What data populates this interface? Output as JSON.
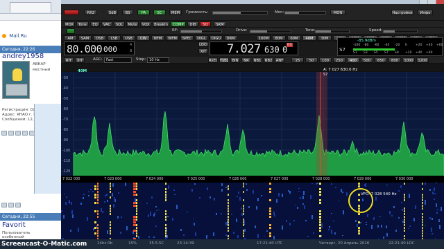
{
  "browser": {
    "bookmark": "Mail.Ru",
    "post1_date": "Сегодня, 22:26",
    "post1_user": "andrey1958",
    "post1_role": "АВКАР",
    "post1_status": "местный",
    "post1_reg": "Регистрация: 02.12.2010",
    "post1_addr": "Адрес: ЯНАО г. Ноябрьск",
    "post1_msgs": "Сообщений: 12,257",
    "post2_date": "Сегодня, 22:55",
    "post2_user": "Favorit",
    "post2_role": "Пользователь",
    "post2_status": "особенный"
  },
  "app": {
    "row1": {
      "buttons": [
        "RX2",
        "SdB",
        "BS",
        "PA",
        "SC",
        "MEM"
      ],
      "volume_label": "Громкость:",
      "mon_label": "Mon:",
      "mon_value": "MON",
      "settings": "Настройки",
      "info": "Инфо"
    },
    "row2": {
      "buttons": [
        "MOX",
        "Tone",
        "EQ",
        "VAC",
        "SQL",
        "Mute",
        "VOX",
        "BreakIn",
        "COMP",
        "DIB",
        "SQ",
        "SKM"
      ],
      "rf_label": "RF:",
      "drive_label": "Drive:",
      "tone_label": "Tone:",
      "speed_label": "Speed:"
    },
    "modes": [
      "AM",
      "SAM",
      "DSB",
      "LSB",
      "USB",
      "CW",
      "NFM",
      "WFM",
      "SPEC",
      "DIGL",
      "DIGU",
      "DRM"
    ],
    "bands": [
      "160M",
      "80M",
      "60M",
      "40M",
      "30M",
      "20M",
      "17M",
      "15M",
      "12M",
      "10M",
      "6M",
      "2M"
    ],
    "vfo_a": {
      "int": "80.000",
      "dec": "000",
      "label_a": "A",
      "label_b": "B"
    },
    "vfo_b": {
      "int": "7.027",
      "dec": "630",
      "dec2": "0",
      "lock": "LOCK",
      "lock2": "XIT",
      "rx": "RX"
    },
    "smeter": {
      "reading": "-85.9dBm",
      "s_label": "S7",
      "scale_top": [
        "-100",
        "-80",
        "-60",
        "-40",
        "-20",
        "0",
        "+20",
        "+40",
        "+60"
      ],
      "scale_bot": [
        "S1",
        "S3",
        "S5",
        "S7",
        "S9",
        "+20",
        "+40",
        "+60"
      ]
    },
    "row5": {
      "rit": "RIT",
      "xit": "XIT",
      "agc_label": "AGC:",
      "agc_value": "Fast",
      "step_label": "Step:",
      "step_value": "10 Hz",
      "flags": [
        "RxEq",
        "TxEq",
        "BIN",
        "NR",
        "NB1",
        "NB2",
        "ANF"
      ],
      "filters": [
        "25",
        "50",
        "100",
        "250",
        "400",
        "500",
        "650",
        "800",
        "1000",
        "1200"
      ]
    },
    "spectrum": {
      "band_label": "40M",
      "cursor_freq": "A: 7 027 630.0 Hz",
      "cursor_sub": "S7",
      "db_ticks": [
        "-30",
        "-40",
        "-50",
        "-60",
        "-70",
        "-80",
        "-90",
        "-100",
        "-110",
        "-120"
      ],
      "freq_ticks": [
        "7 022 000",
        "7 023 000",
        "7 024 000",
        "7 025 000",
        "7 026 000",
        "7 027 000",
        "7 028 000",
        "7 029 000",
        "7 030 000"
      ]
    },
    "waterfall": {
      "annotation": "VFO: 7 028 540 Hz"
    }
  },
  "status": {
    "watermark": "Screencast-O-Matic.com",
    "items": [
      "14hz.0b",
      "15%",
      "35.5.5C",
      "23:14:39",
      "17:21:40 UTC",
      "Четверг, 20 Апрель 2016",
      "22:21:40 LOC"
    ]
  },
  "colors": {
    "spectrum_fill": "#1f9c44",
    "spectrum_bg": "#0b1a3c",
    "waterfall_bg": "#06103a",
    "highlight_circle": "#f0e020",
    "cursor_red": "#c0392b"
  }
}
